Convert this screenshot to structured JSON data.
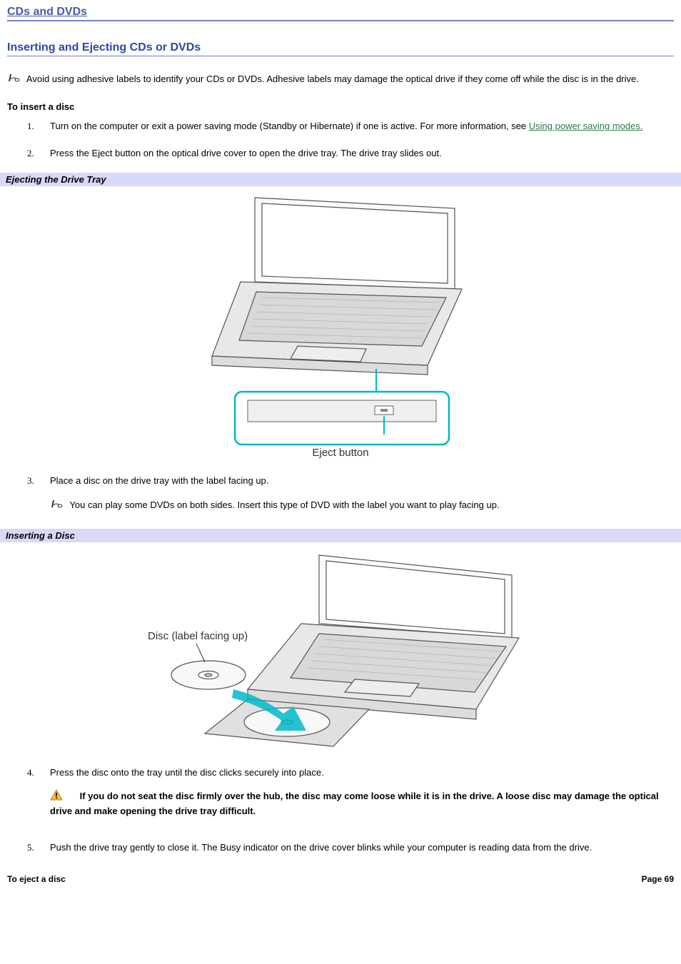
{
  "header": {
    "title": "CDs and DVDs"
  },
  "section": {
    "title": "Inserting and Ejecting CDs or DVDs"
  },
  "note1": "Avoid using adhesive labels to identify your CDs or DVDs. Adhesive labels may damage the optical drive if they come off while the disc is in the drive.",
  "insert": {
    "heading": "To insert a disc",
    "steps": {
      "s1a": "Turn on the computer or exit a power saving mode (Standby or Hibernate) if one is active. For more information, see ",
      "s1link": "Using power saving modes.",
      "s2": "Press the Eject button on the optical drive cover to open the drive tray. The drive tray slides out.",
      "s3": "Place a disc on the drive tray with the label facing up.",
      "s3note": "You can play some DVDs on both sides. Insert this type of DVD with the label you want to play facing up.",
      "s4": "Press the disc onto the tray until the disc clicks securely into place.",
      "s4warn": "If you do not seat the disc firmly over the hub, the disc may come loose while it is in the drive. A loose disc may damage the optical drive and make opening the drive tray difficult.",
      "s5": "Push the drive tray gently to close it. The Busy indicator on the drive cover blinks while your computer is reading data from the drive."
    }
  },
  "captions": {
    "fig1": "Ejecting the Drive Tray",
    "fig2": "Inserting a Disc"
  },
  "callouts": {
    "eject": "Eject button",
    "disc": "Disc (label facing up)"
  },
  "eject": {
    "heading": "To eject a disc"
  },
  "footer": {
    "page": "Page 69"
  }
}
